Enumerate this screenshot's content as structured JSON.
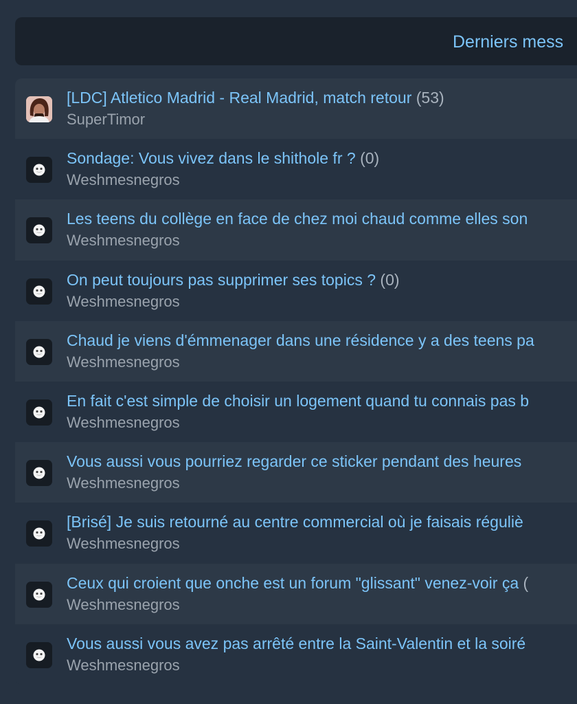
{
  "header": {
    "title": "Derniers mess"
  },
  "topics": [
    {
      "title": "[LDC] Atletico Madrid - Real Madrid, match retour",
      "count": "(53)",
      "author": "SuperTimor",
      "avatar": "user-photo-avatar"
    },
    {
      "title": "Sondage: Vous vivez dans le shithole fr ?",
      "count": "(0)",
      "author": "Weshmesnegros",
      "avatar": "default-smiley-avatar"
    },
    {
      "title": "Les teens du collège en face de chez moi chaud comme elles son",
      "count": "",
      "author": "Weshmesnegros",
      "avatar": "default-smiley-avatar"
    },
    {
      "title": "On peut toujours pas supprimer ses topics ?",
      "count": "(0)",
      "author": "Weshmesnegros",
      "avatar": "default-smiley-avatar"
    },
    {
      "title": "Chaud je viens d'émmenager dans une résidence y a des teens pa",
      "count": "",
      "author": "Weshmesnegros",
      "avatar": "default-smiley-avatar"
    },
    {
      "title": "En fait c'est simple de choisir un logement quand tu connais pas b",
      "count": "",
      "author": "Weshmesnegros",
      "avatar": "default-smiley-avatar"
    },
    {
      "title": "Vous aussi vous pourriez regarder ce sticker pendant des heures",
      "count": "",
      "author": "Weshmesnegros",
      "avatar": "default-smiley-avatar"
    },
    {
      "title": "[Brisé] Je suis retourné au centre commercial où je faisais réguliè",
      "count": "",
      "author": "Weshmesnegros",
      "avatar": "default-smiley-avatar"
    },
    {
      "title": "Ceux qui croient que onche est un forum \"glissant\" venez-voir ça",
      "count": "(",
      "author": "Weshmesnegros",
      "avatar": "default-smiley-avatar"
    },
    {
      "title": "Vous aussi vous avez pas arrêté entre la Saint-Valentin et la soiré",
      "count": "",
      "author": "Weshmesnegros",
      "avatar": "default-smiley-avatar"
    }
  ],
  "colors": {
    "page_background": "#263241",
    "header_background": "#1a222c",
    "row_alt_background": "#2d3947",
    "link": "#7cc4f8",
    "muted_text": "#9aa3ad"
  }
}
